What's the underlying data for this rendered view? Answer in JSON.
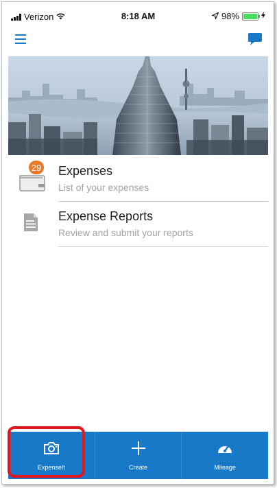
{
  "status_bar": {
    "carrier": "Verizon",
    "time": "8:18 AM",
    "battery": "98%",
    "battery_level": 0.98
  },
  "nav": {
    "menu_icon": "hamburger-menu-icon",
    "chat_icon": "chat-bubble-icon"
  },
  "list": {
    "items": [
      {
        "title": "Expenses",
        "subtitle": "List of your expenses",
        "badge": "29",
        "icon": "wallet-icon"
      },
      {
        "title": "Expense Reports",
        "subtitle": "Review and submit your reports",
        "icon": "document-icon"
      }
    ]
  },
  "tab_bar": {
    "tabs": [
      {
        "label": "ExpenseIt",
        "icon": "camera-icon"
      },
      {
        "label": "Create",
        "icon": "plus-icon"
      },
      {
        "label": "Mileage",
        "icon": "speedometer-icon"
      }
    ]
  },
  "colors": {
    "accent": "#1879c9",
    "badge": "#e8782a",
    "highlight": "#e2161c"
  }
}
